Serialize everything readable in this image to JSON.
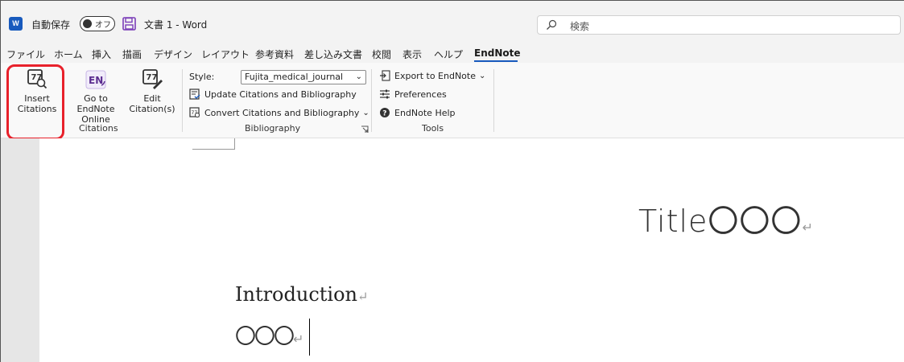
{
  "titlebar": {
    "app_icon": "word-icon",
    "autosave_label": "自動保存",
    "autosave_state": "オフ",
    "doc_title": "文書 1  -  Word",
    "search_placeholder": "検索"
  },
  "menu": {
    "tabs": [
      "ファイル",
      "ホーム",
      "挿入",
      "描画",
      "デザイン",
      "レイアウト",
      "参考資料",
      "差し込み文書",
      "校閲",
      "表示",
      "ヘルプ",
      "EndNote"
    ],
    "active_tab": "EndNote"
  },
  "ribbon": {
    "citations": {
      "insert_label_1": "Insert",
      "insert_label_2": "Citations",
      "goto_label_1": "Go to EndNote",
      "goto_label_2": "Online",
      "edit_label_1": "Edit",
      "edit_label_2": "Citation(s)",
      "en_badge": "EN",
      "group_label": "Citations"
    },
    "bibliography": {
      "style_label": "Style:",
      "style_value": "Fujita_medical_journal",
      "update_label": "Update Citations and Bibliography",
      "convert_label": "Convert Citations and Bibliography",
      "group_label": "Bibliography"
    },
    "tools": {
      "export_label": "Export to EndNote",
      "preferences_label": "Preferences",
      "help_label": "EndNote Help",
      "group_label": "Tools"
    }
  },
  "document": {
    "title_text": "Title〇〇〇",
    "heading_text": "Introduction",
    "body_text": "〇〇〇",
    "paragraph_mark": "↵"
  },
  "colors": {
    "accent": "#185abd",
    "highlight": "#e8212b",
    "endnote_purple": "#5b2d90"
  }
}
